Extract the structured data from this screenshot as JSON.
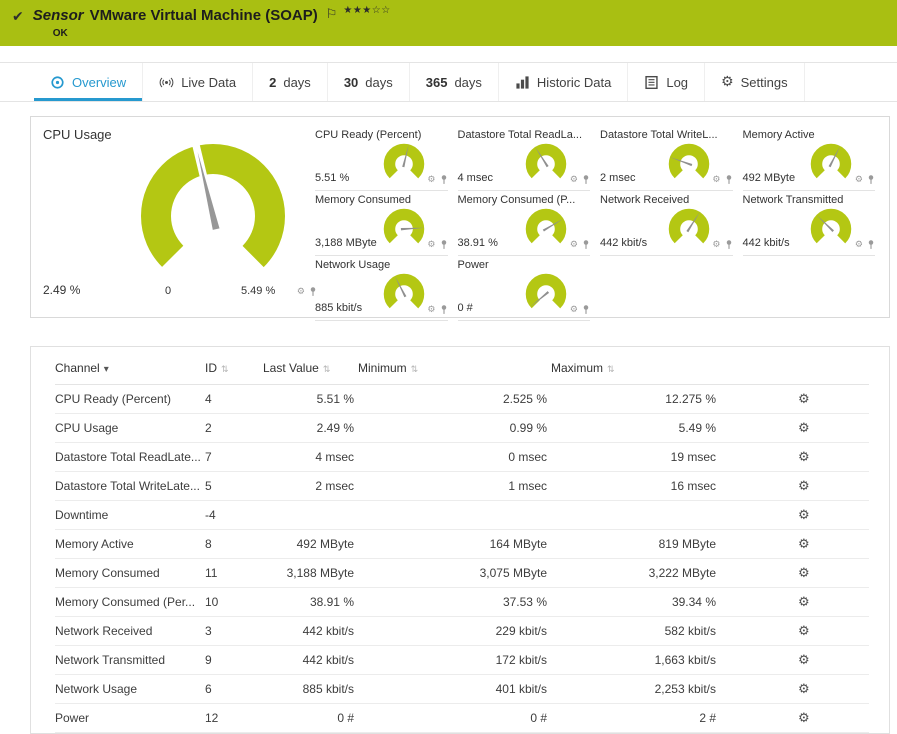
{
  "colors": {
    "banner_green": "#a9bf12",
    "gauge_green": "#b4c713",
    "active_tab_blue": "#2699cf"
  },
  "header": {
    "check_glyph": "✔",
    "kind": "Sensor",
    "title": "VMware Virtual Machine (SOAP)",
    "flag_glyph": "⚐",
    "status": "OK",
    "rating": {
      "filled": 3,
      "total": 5
    }
  },
  "tabs": [
    {
      "id": "overview",
      "icon": "overview",
      "label": "Overview",
      "active": true
    },
    {
      "id": "live-data",
      "icon": "live-data",
      "label": "Live Data"
    },
    {
      "id": "2-days",
      "num": "2",
      "label": "days"
    },
    {
      "id": "30-days",
      "num": "30",
      "label": "days"
    },
    {
      "id": "365-days",
      "num": "365",
      "label": "days"
    },
    {
      "id": "historic-data",
      "icon": "historic-data",
      "label": "Historic Data"
    },
    {
      "id": "log",
      "icon": "log",
      "label": "Log"
    },
    {
      "id": "settings",
      "icon": "settings",
      "label": "Settings"
    }
  ],
  "main_gauge": {
    "title": "CPU Usage",
    "value_label": "2.49 %",
    "min_label": "0",
    "max_label": "5.49 %",
    "fraction": 0.45
  },
  "mini_gauges": [
    {
      "title": "CPU Ready (Percent)",
      "value": "5.51 %",
      "fraction": 0.55
    },
    {
      "title": "Datastore Total ReadLa...",
      "value": "4 msec",
      "fraction": 0.38
    },
    {
      "title": "Datastore Total WriteL...",
      "value": "2 msec",
      "fraction": 0.24
    },
    {
      "title": "Memory Active",
      "value": "492 MByte",
      "fraction": 0.6
    },
    {
      "title": "Memory Consumed",
      "value": "3,188 MByte",
      "fraction": 0.82
    },
    {
      "title": "Memory Consumed (P...",
      "value": "38.91 %",
      "fraction": 0.72
    },
    {
      "title": "Network Received",
      "value": "442 kbit/s",
      "fraction": 0.62
    },
    {
      "title": "Network Transmitted",
      "value": "442 kbit/s",
      "fraction": 0.33
    },
    {
      "title": "Network Usage",
      "value": "885 kbit/s",
      "fraction": 0.4
    },
    {
      "title": "Power",
      "value": "0 #",
      "fraction": 0.02
    }
  ],
  "table": {
    "columns": [
      {
        "label": "Channel",
        "arrow": "▾"
      },
      {
        "label": "ID",
        "arrow": "⇅"
      },
      {
        "label": "Last Value",
        "arrow": "⇅"
      },
      {
        "label": "Minimum",
        "arrow": "⇅"
      },
      {
        "label": "Maximum",
        "arrow": "⇅"
      }
    ],
    "rows": [
      [
        "CPU Ready (Percent)",
        "4",
        "5.51 %",
        "2.525 %",
        "12.275 %"
      ],
      [
        "CPU Usage",
        "2",
        "2.49 %",
        "0.99 %",
        "5.49 %"
      ],
      [
        "Datastore Total ReadLate...",
        "7",
        "4 msec",
        "0 msec",
        "19 msec"
      ],
      [
        "Datastore Total WriteLate...",
        "5",
        "2 msec",
        "1 msec",
        "16 msec"
      ],
      [
        "Downtime",
        "-4",
        "",
        "",
        ""
      ],
      [
        "Memory Active",
        "8",
        "492 MByte",
        "164 MByte",
        "819 MByte"
      ],
      [
        "Memory Consumed",
        "11",
        "3,188 MByte",
        "3,075 MByte",
        "3,222 MByte"
      ],
      [
        "Memory Consumed (Per...",
        "10",
        "38.91 %",
        "37.53 %",
        "39.34 %"
      ],
      [
        "Network Received",
        "3",
        "442 kbit/s",
        "229 kbit/s",
        "582 kbit/s"
      ],
      [
        "Network Transmitted",
        "9",
        "442 kbit/s",
        "172 kbit/s",
        "1,663 kbit/s"
      ],
      [
        "Network Usage",
        "6",
        "885 kbit/s",
        "401 kbit/s",
        "2,253 kbit/s"
      ],
      [
        "Power",
        "12",
        "0 #",
        "0 #",
        "2 #"
      ]
    ]
  }
}
